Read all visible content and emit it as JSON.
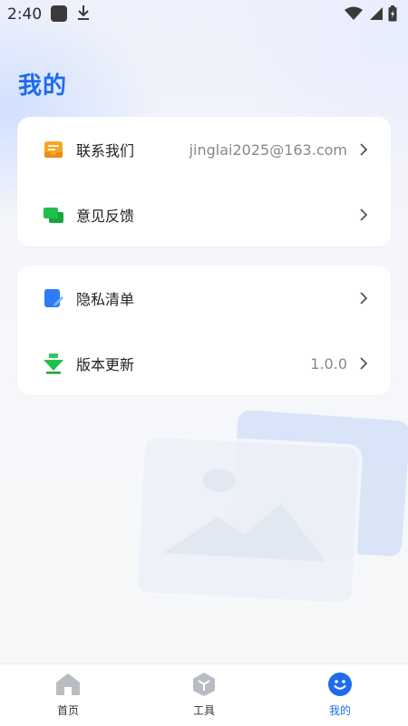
{
  "status_bar": {
    "time": "2:40",
    "icons": [
      "app-icon",
      "download-icon",
      "wifi-icon",
      "signal-icon",
      "battery-icon"
    ]
  },
  "page": {
    "title": "我的"
  },
  "card1": {
    "items": [
      {
        "label": "联系我们",
        "value": "jinglai2025@163.com",
        "icon": "inbox-icon"
      },
      {
        "label": "意见反馈",
        "value": "",
        "icon": "chat-bubbles-icon"
      }
    ]
  },
  "card2": {
    "items": [
      {
        "label": "隐私清单",
        "value": "",
        "icon": "privacy-doc-icon"
      },
      {
        "label": "版本更新",
        "value": "1.0.0",
        "icon": "download-arrow-icon"
      }
    ]
  },
  "bottom_nav": {
    "items": [
      {
        "label": "首页",
        "icon": "home-icon",
        "active": false
      },
      {
        "label": "工具",
        "icon": "cube-icon",
        "active": false
      },
      {
        "label": "我的",
        "icon": "smiley-icon",
        "active": true
      }
    ]
  },
  "colors": {
    "accent": "#1e6bf0",
    "inactive_icon": "#b9bcc2",
    "orange": "#f6a623",
    "green": "#1fbf4f",
    "blue": "#2f7bf5"
  }
}
